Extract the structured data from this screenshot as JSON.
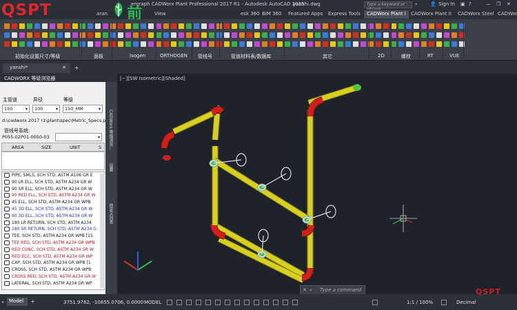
{
  "title": {
    "part1": "ergraph CADWorx Plant Professional 2017 R1 - Autodesk AutoCAD 2015",
    "filename": "yanshi.dwg",
    "search_placeholder": "Type a keyword or phrase",
    "signin": "Sign In"
  },
  "brand": {
    "logo_text": "QSPT",
    "cn_text": "前山智造"
  },
  "tabs": [
    "aran",
    "View",
    "esk 360",
    "BIM 360",
    "Featured Apps",
    "Express Tools",
    "CADWorx Plant I",
    "CADWorx Plant II",
    "CADWorx Steel",
    "CADWorx"
  ],
  "active_tab": "CADWorx Plant I",
  "ribbon_panels": [
    "初始化设置尺寸/等级",
    "面板",
    "Isogen",
    "ORTHOGEN",
    "管线号",
    "管道材料表/数据库",
    "其它",
    "2D",
    "螺栓",
    "RT",
    "VUE"
  ],
  "doc_tab": "yanshi*",
  "palette": {
    "header": "CADWORX 等级浏览器",
    "labels": {
      "main": "主管道",
      "reducer": "异径",
      "spec": "等级"
    },
    "values": {
      "main": "150",
      "reducer": "100",
      "spec": "150_MM"
    },
    "spec_path": "d:\\cadworx 2017 r1\\plant\\spec\\Metric_Specs.prj",
    "line_label": "管线号系统:",
    "line_value": "P055-02P01-0050-03",
    "columns": [
      "AREA",
      "SIZE",
      "UNIT",
      "S"
    ],
    "items": [
      {
        "text": "PIPE, SMLS, SCH STD, ASTM A106 GR E",
        "color": "#111111"
      },
      {
        "text": "90 LR ELL, SCH STD, ASTM A234 GR W",
        "color": "#111111"
      },
      {
        "text": "90 SR ELL, SCH STD, ASTM A234 GR W",
        "color": "#111111"
      },
      {
        "text": "90 RED ELL, SCH STD, ASTM A234 GR W",
        "color": "#c0121a"
      },
      {
        "text": "45 ELL, SCH STD, ASTM A234 GR WPB",
        "color": "#111111"
      },
      {
        "text": "45 3D ELL, SCH STD, ASTM A234 GR W",
        "color": "#1a2fb0"
      },
      {
        "text": "90 3D ELL, SCH STD, ASTM A234 GR W",
        "color": "#1a2fb0"
      },
      {
        "text": "180 LR RETURN, SCH STD, ASTM A234",
        "color": "#111111"
      },
      {
        "text": "180 SR RETURN, SCH STD, ASTM A234 G",
        "color": "#1a2fb0"
      },
      {
        "text": "TEE, SCH STD, ASTM A234 GR WPB [1S",
        "color": "#111111"
      },
      {
        "text": "TEE RED, SCH STD, ASTM A234 GR WPB",
        "color": "#c0121a"
      },
      {
        "text": "RED CONC, SCH STD, ASTM A234 GR W",
        "color": "#c0121a"
      },
      {
        "text": "RED ECC, SCH STD, ASTM A234 GR WP",
        "color": "#c0121a"
      },
      {
        "text": "CAP, SCH STD, ASTM A234 GR WPB [1",
        "color": "#111111"
      },
      {
        "text": "CROSS, SCH STD, ASTM A234 GR WPB",
        "color": "#111111"
      },
      {
        "text": "CROSS RED, SCH STD, ASTM A234 GR W",
        "color": "#c0121a"
      },
      {
        "text": "LATERAL, SCH STD, ASTM A234 GR WP",
        "color": "#111111"
      }
    ],
    "vtabs": [
      "CADWorx 等级浏览...",
      "设置",
      "自定义列表"
    ]
  },
  "viewport": {
    "label": "[−][SW Isometric][Shaded]"
  },
  "status": {
    "model_tab": "Model",
    "coords": "3751.9762, -10855.0706, 0.0000",
    "mode": "MODEL",
    "scale": "1:1 / 100%",
    "units": "Decimal",
    "command_placeholder": "Type a command",
    "watermark": "QSPT"
  },
  "colors": {
    "pipe": "#d8d020",
    "elbow": "#d0201c",
    "flange": "#58c040",
    "bg": "#1e232b"
  }
}
